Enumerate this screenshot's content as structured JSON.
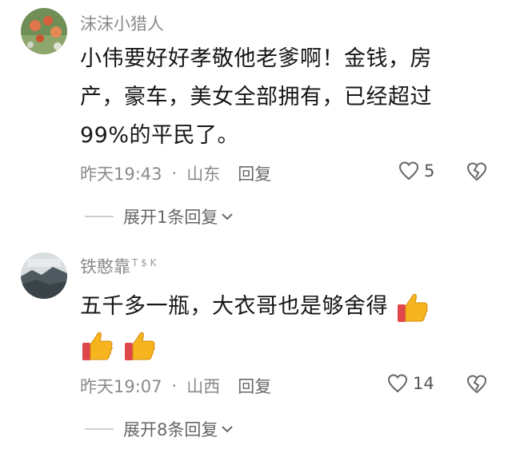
{
  "comments": [
    {
      "username": "沫沫小猎人",
      "text_lines": [
        "小伟要好好孝敬他老爹啊！金钱，房",
        "产，豪车，美女全部拥有，已经超过",
        "99%的平民了。"
      ],
      "time": "昨天19:43",
      "location": "山东",
      "reply_label": "回复",
      "likes": "5",
      "expand_label": "展开1条回复"
    },
    {
      "username": "铁憨靠",
      "username_tag": "T $ K",
      "text_lines": [
        "五千多一瓶，大衣哥也是够舍得"
      ],
      "time": "昨天19:07",
      "location": "山西",
      "reply_label": "回复",
      "likes": "14",
      "expand_label": "展开8条回复"
    }
  ],
  "separator": "·",
  "icons": {
    "like": "heart-outline-icon",
    "dislike": "broken-heart-icon",
    "expand": "chevron-down-icon",
    "emoji": "thumbs-up-emoji"
  }
}
